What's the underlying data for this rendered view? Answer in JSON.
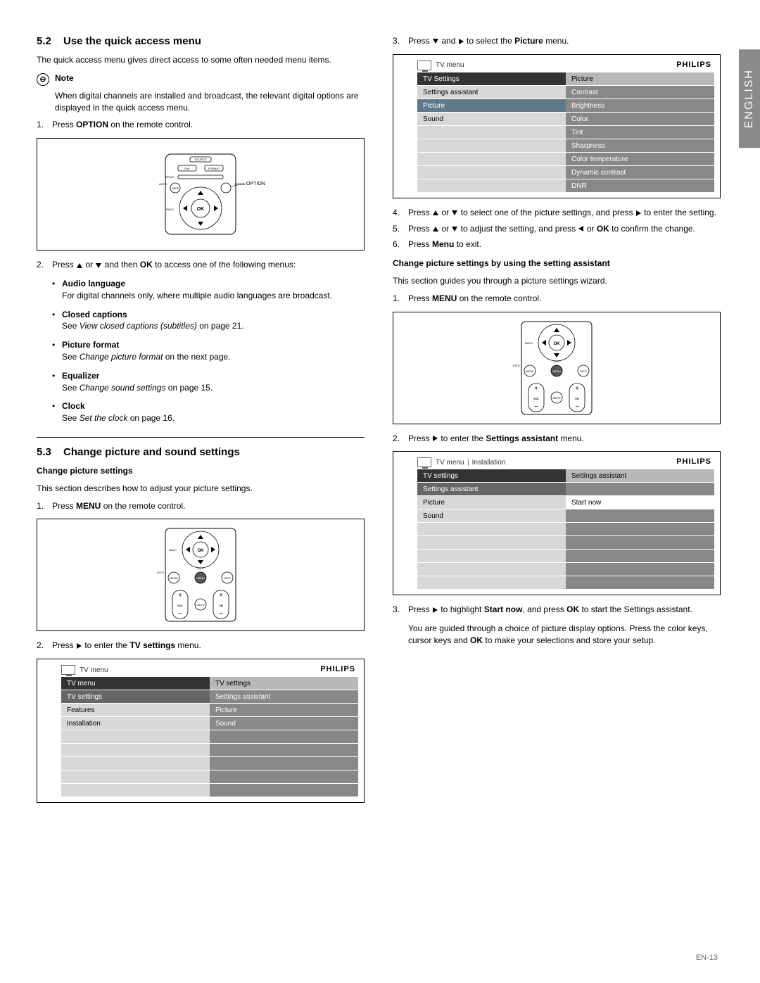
{
  "lang_tab": "ENGLISH",
  "page_number": "EN-13",
  "brand": "PHILIPS",
  "s52": {
    "num": "5.2",
    "title": "Use the quick access menu",
    "intro": "The quick access menu gives direct access to some often needed menu items.",
    "note_label": "Note",
    "note_body": "When digital channels are installed and broadcast, the relevant digital options are displayed in the quick access menu.",
    "step1_a": "Press ",
    "step1_b": "OPTION",
    "step1_c": " on the remote control.",
    "step2_a": "Press ",
    "step2_b": " or ",
    "step2_c": " and then ",
    "step2_d": "OK",
    "step2_e": " to access one of the following menus:",
    "items": [
      {
        "title": "Audio language",
        "body_a": "For digital channels only, where multiple audio languages are broadcast."
      },
      {
        "title": "Closed captions",
        "body_a": "See ",
        "ital": "View closed captions (subtitles)",
        "body_b": " on page 21."
      },
      {
        "title": "Picture format",
        "body_a": "See ",
        "ital": "Change picture format",
        "body_b": " on the next page."
      },
      {
        "title": "Equalizer",
        "body_a": "See ",
        "ital": "Change sound settings",
        "body_b": " on page 15."
      },
      {
        "title": "Clock",
        "body_a": "See ",
        "ital": "Set the clock",
        "body_b": " on page 16."
      }
    ]
  },
  "s53": {
    "num": "5.3",
    "title": "Change picture and sound settings",
    "sub1": "Change picture settings",
    "sub1_intro": "This section describes how to adjust your picture settings.",
    "s1_a": "Press ",
    "s1_b": "MENU",
    "s1_c": " on the remote control.",
    "s2_a": "Press ",
    "s2_b": " to enter the ",
    "s2_c": "TV settings",
    "s2_d": " menu.",
    "menu1": {
      "bc": "TV menu",
      "left_header": "TV menu",
      "right_header": "TV settings",
      "left": [
        "TV settings",
        "Features",
        "Installation"
      ],
      "right": [
        "Settings assistant",
        "Picture",
        "Sound"
      ]
    },
    "s3_a": "Press ",
    "s3_b": " and ",
    "s3_c": " to select the ",
    "s3_d": "Picture",
    "s3_e": " menu.",
    "menu2": {
      "bc": "TV menu",
      "left_header": "TV Settings",
      "right_header": "Picture",
      "left": [
        "Settings assistant",
        "Picture",
        "Sound"
      ],
      "right": [
        "Contrast",
        "Brightness",
        "Color",
        "Tint",
        "Sharpness",
        "Color temperature",
        "Dynamic contrast",
        "DNR"
      ],
      "sel_left_idx": 1
    },
    "s4_a": "Press ",
    "s4_b": " or ",
    "s4_c": " to select one of the picture settings, and press ",
    "s4_d": " to enter the setting.",
    "s5_a": "Press ",
    "s5_b": " or ",
    "s5_c": " to adjust the setting, and press ",
    "s5_d": " or ",
    "s5_e": "OK",
    "s5_f": " to confirm the change.",
    "s6_a": "Press ",
    "s6_b": "Menu",
    "s6_c": " to exit.",
    "sub2": "Change picture settings by using the setting assistant",
    "sub2_intro": "This section guides you through a picture settings wizard.",
    "w1_a": "Press ",
    "w1_b": "MENU",
    "w1_c": " on the remote control.",
    "w2_a": "Press ",
    "w2_b": " to enter the ",
    "w2_c": "Settings assistant",
    "w2_d": " menu.",
    "menu3": {
      "bc1": "TV menu",
      "bc2": "Installation",
      "left_header": "TV settings",
      "right_header": "Settings assistant",
      "left": [
        "Settings assistant",
        "Picture",
        "Sound"
      ],
      "right": [
        "",
        "Start now"
      ]
    },
    "w3_a": "Press ",
    "w3_b": " to highlight ",
    "w3_c": "Start now",
    "w3_d": ", and press ",
    "w3_e": "OK",
    "w3_f": " to start the Settings assistant.",
    "w_out": "You are guided through a choice of picture display options.  Press the color keys, cursor keys and ",
    "w_out_b": "OK",
    "w_out_c": " to make your selections and store your setup."
  }
}
